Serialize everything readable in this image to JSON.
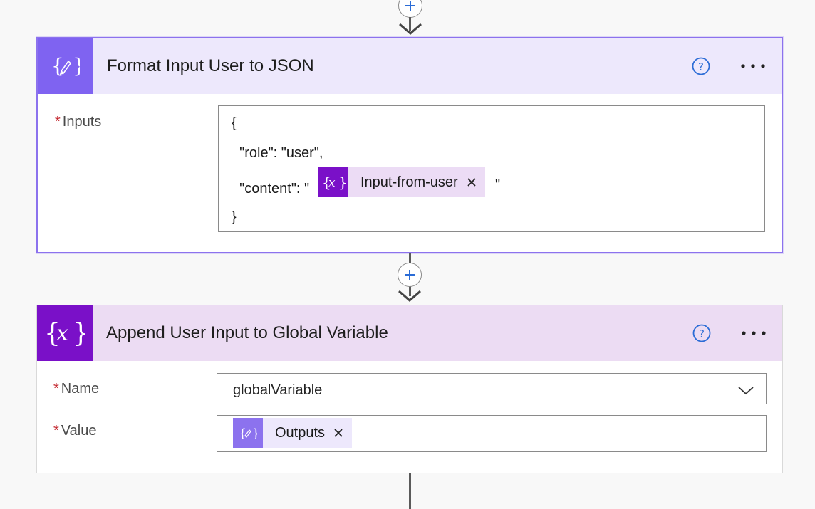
{
  "flow": {
    "steps": [
      {
        "title": "Format Input User to JSON",
        "icon": "compose-braces-icon",
        "fields": {
          "inputs_label": "Inputs",
          "code_lines": [
            "{",
            "  \"role\": \"user\",",
            "  \"content\": \"",
            "\"",
            "}"
          ],
          "token_label": "Input-from-user"
        }
      },
      {
        "title": "Append User Input to Global Variable",
        "icon": "variable-icon",
        "fields": {
          "name_label": "Name",
          "name_value": "globalVariable",
          "value_label": "Value",
          "value_token_label": "Outputs"
        }
      }
    ]
  },
  "colors": {
    "compose_accent": "#7f63f1",
    "variable_accent": "#7a10c8",
    "required_mark": "#c3262e",
    "help_icon": "#2b6cd6"
  },
  "required_mark": "*"
}
